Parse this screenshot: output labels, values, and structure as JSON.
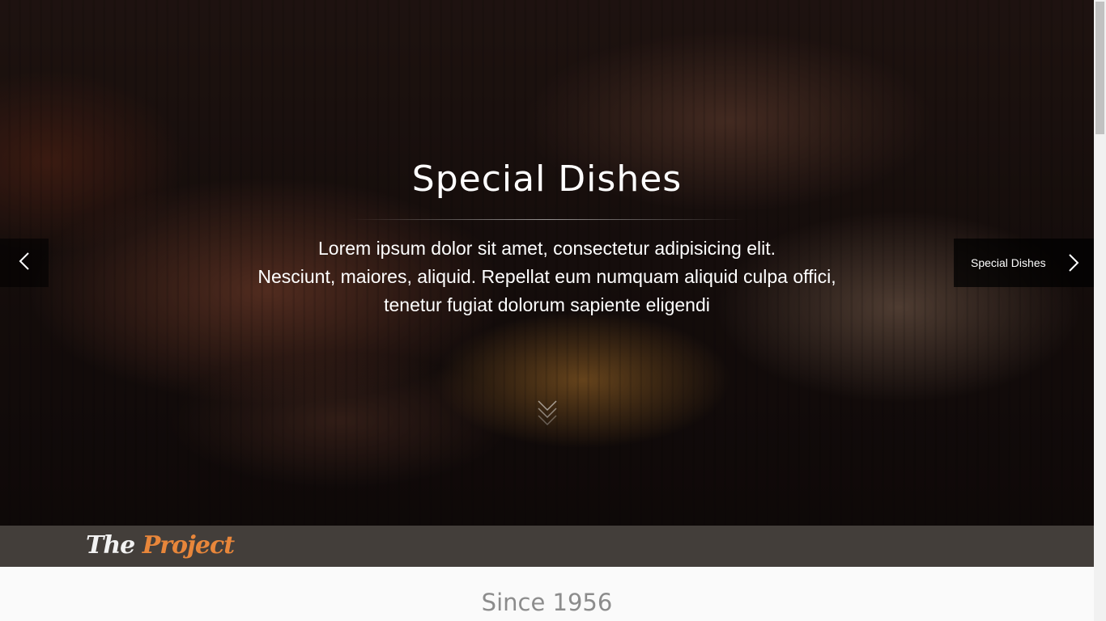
{
  "hero": {
    "title": "Special Dishes",
    "text_lines": [
      "Lorem ipsum dolor sit amet, consectetur adipisicing elit.",
      "Nesciunt, maiores, aliquid. Repellat eum numquam aliquid culpa offici,",
      "tenetur fugiat dolorum sapiente eligendi"
    ],
    "scroll_icon": "double-chevron-down-icon"
  },
  "slider": {
    "prev_icon": "chevron-left-icon",
    "next_label": "Special Dishes",
    "next_icon": "chevron-right-icon"
  },
  "navbar": {
    "logo_the": "The",
    "logo_project": "Project",
    "logo_accent_color": "#e8863a",
    "background_color": "#433e3a"
  },
  "section": {
    "title": "Since 1956"
  }
}
